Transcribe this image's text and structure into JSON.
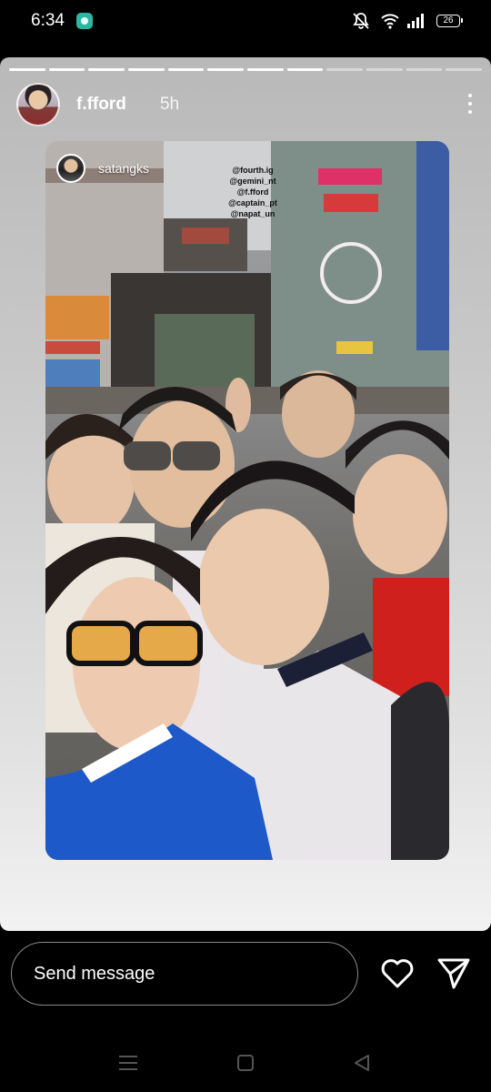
{
  "status_bar": {
    "time": "6:34",
    "battery": "26"
  },
  "story": {
    "username": "f.fford",
    "time_ago": "5h",
    "progress_segments": 12,
    "progress_completed": 8,
    "repost": {
      "username": "satangks",
      "mentions": [
        "@fourth.ig",
        "@gemini_nt",
        "@f.fford",
        "@captain_pt",
        "@napat_un"
      ]
    }
  },
  "reply_bar": {
    "message_placeholder": "Send message"
  },
  "icons": {
    "like": "heart-icon",
    "share": "send-icon",
    "more": "more-icon"
  }
}
